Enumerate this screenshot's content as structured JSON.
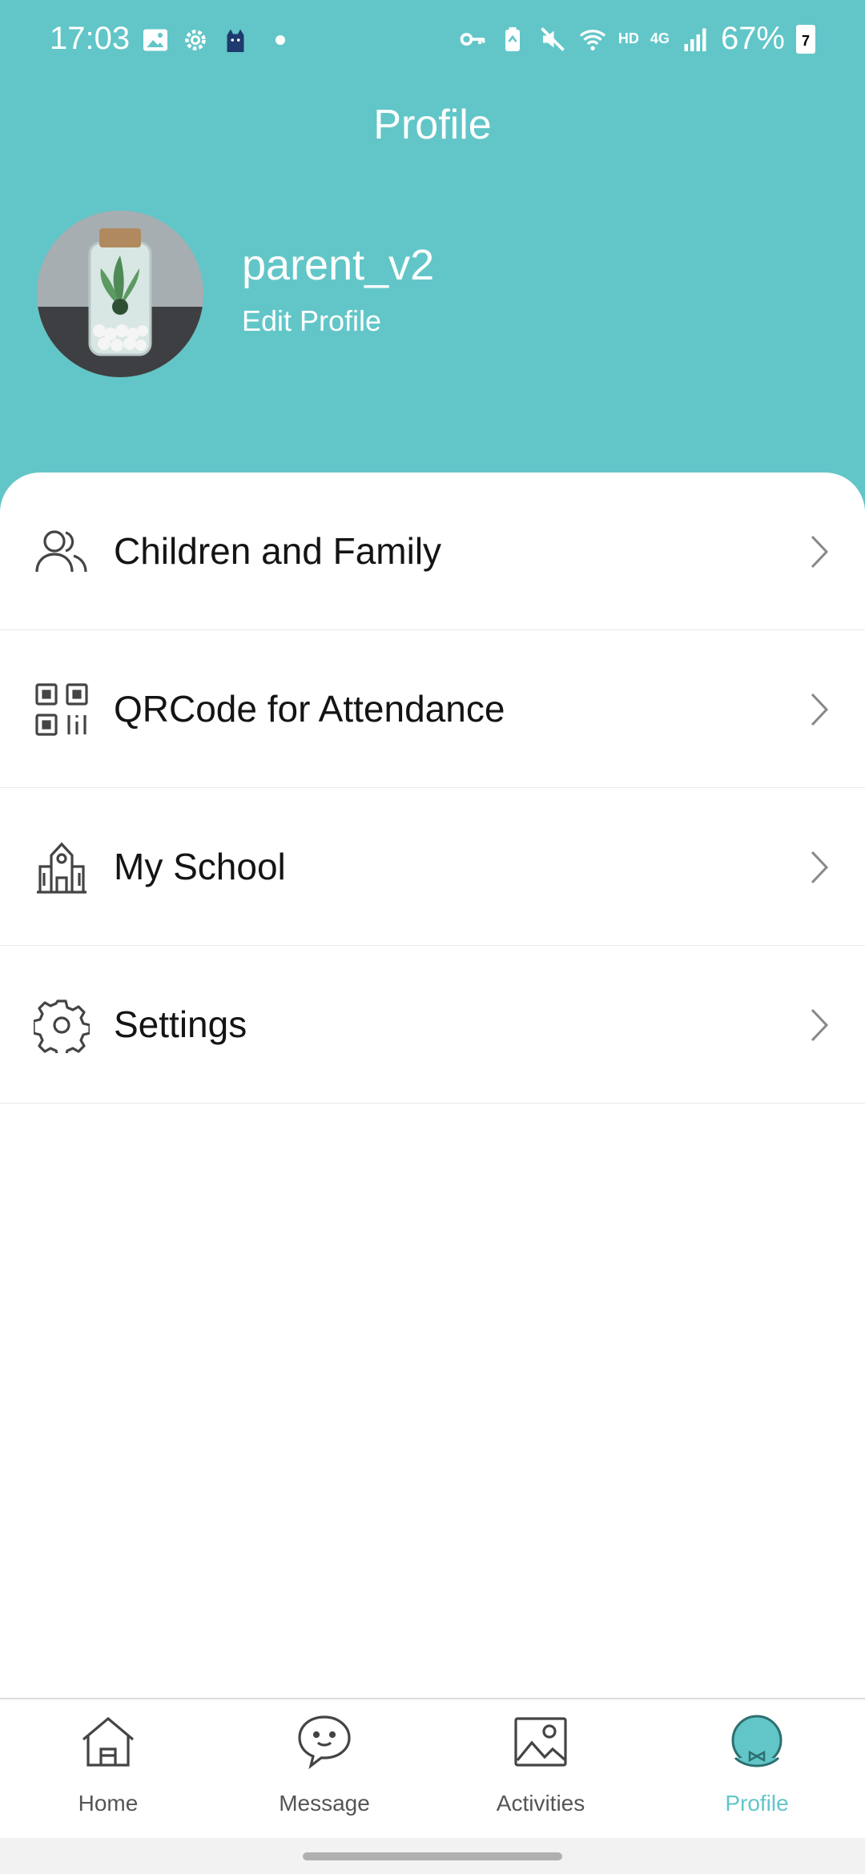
{
  "status_bar": {
    "time": "17:03",
    "network_hd": "HD",
    "network_4g": "4G",
    "battery_percent": "67%",
    "battery_badge": "7"
  },
  "header": {
    "title": "Profile",
    "username": "parent_v2",
    "edit_profile_label": "Edit Profile"
  },
  "menu": {
    "items": [
      {
        "label": "Children and Family",
        "icon": "people-icon"
      },
      {
        "label": "QRCode for Attendance",
        "icon": "qrcode-icon"
      },
      {
        "label": "My School",
        "icon": "school-icon"
      },
      {
        "label": "Settings",
        "icon": "gear-icon"
      }
    ]
  },
  "bottom_nav": {
    "items": [
      {
        "label": "Home",
        "icon": "home-icon"
      },
      {
        "label": "Message",
        "icon": "chat-bubble-icon"
      },
      {
        "label": "Activities",
        "icon": "image-icon"
      },
      {
        "label": "Profile",
        "icon": "profile-icon",
        "active": true
      }
    ]
  },
  "colors": {
    "accent": "#62c6c8",
    "text": "#141414",
    "nav_inactive": "#555555"
  }
}
